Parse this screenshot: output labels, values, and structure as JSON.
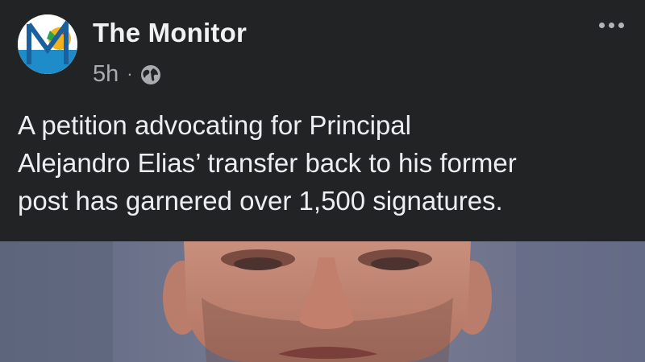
{
  "post": {
    "page_name": "The Monitor",
    "timestamp": "5h",
    "separator": "·",
    "audience_icon": "globe-icon",
    "more_icon": "more-options-icon",
    "text": "A petition advocating for Principal\nAlejandro Elias’ transfer back to his former\npost has garnered over 1,500 signatures.",
    "avatar_letter": "M",
    "photo_icon": "person-photo"
  },
  "colors": {
    "background": "#222325",
    "text": "#eceef1",
    "meta": "#a9abb0",
    "photo_background": "#6d7289"
  }
}
